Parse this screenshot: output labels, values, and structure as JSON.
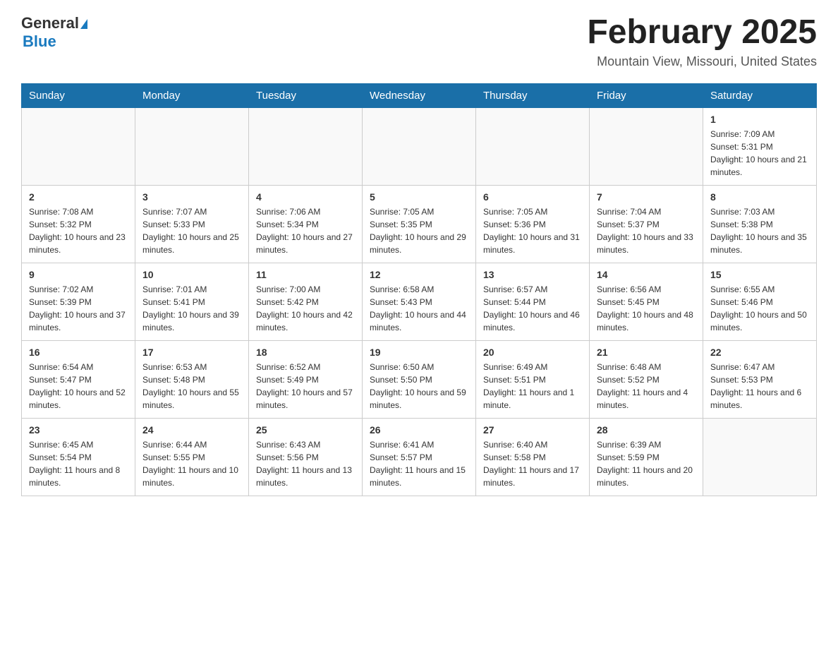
{
  "header": {
    "logo_general": "General",
    "logo_blue": "Blue",
    "month_title": "February 2025",
    "location": "Mountain View, Missouri, United States"
  },
  "days_of_week": [
    "Sunday",
    "Monday",
    "Tuesday",
    "Wednesday",
    "Thursday",
    "Friday",
    "Saturday"
  ],
  "weeks": [
    [
      {
        "day": "",
        "info": ""
      },
      {
        "day": "",
        "info": ""
      },
      {
        "day": "",
        "info": ""
      },
      {
        "day": "",
        "info": ""
      },
      {
        "day": "",
        "info": ""
      },
      {
        "day": "",
        "info": ""
      },
      {
        "day": "1",
        "info": "Sunrise: 7:09 AM\nSunset: 5:31 PM\nDaylight: 10 hours and 21 minutes."
      }
    ],
    [
      {
        "day": "2",
        "info": "Sunrise: 7:08 AM\nSunset: 5:32 PM\nDaylight: 10 hours and 23 minutes."
      },
      {
        "day": "3",
        "info": "Sunrise: 7:07 AM\nSunset: 5:33 PM\nDaylight: 10 hours and 25 minutes."
      },
      {
        "day": "4",
        "info": "Sunrise: 7:06 AM\nSunset: 5:34 PM\nDaylight: 10 hours and 27 minutes."
      },
      {
        "day": "5",
        "info": "Sunrise: 7:05 AM\nSunset: 5:35 PM\nDaylight: 10 hours and 29 minutes."
      },
      {
        "day": "6",
        "info": "Sunrise: 7:05 AM\nSunset: 5:36 PM\nDaylight: 10 hours and 31 minutes."
      },
      {
        "day": "7",
        "info": "Sunrise: 7:04 AM\nSunset: 5:37 PM\nDaylight: 10 hours and 33 minutes."
      },
      {
        "day": "8",
        "info": "Sunrise: 7:03 AM\nSunset: 5:38 PM\nDaylight: 10 hours and 35 minutes."
      }
    ],
    [
      {
        "day": "9",
        "info": "Sunrise: 7:02 AM\nSunset: 5:39 PM\nDaylight: 10 hours and 37 minutes."
      },
      {
        "day": "10",
        "info": "Sunrise: 7:01 AM\nSunset: 5:41 PM\nDaylight: 10 hours and 39 minutes."
      },
      {
        "day": "11",
        "info": "Sunrise: 7:00 AM\nSunset: 5:42 PM\nDaylight: 10 hours and 42 minutes."
      },
      {
        "day": "12",
        "info": "Sunrise: 6:58 AM\nSunset: 5:43 PM\nDaylight: 10 hours and 44 minutes."
      },
      {
        "day": "13",
        "info": "Sunrise: 6:57 AM\nSunset: 5:44 PM\nDaylight: 10 hours and 46 minutes."
      },
      {
        "day": "14",
        "info": "Sunrise: 6:56 AM\nSunset: 5:45 PM\nDaylight: 10 hours and 48 minutes."
      },
      {
        "day": "15",
        "info": "Sunrise: 6:55 AM\nSunset: 5:46 PM\nDaylight: 10 hours and 50 minutes."
      }
    ],
    [
      {
        "day": "16",
        "info": "Sunrise: 6:54 AM\nSunset: 5:47 PM\nDaylight: 10 hours and 52 minutes."
      },
      {
        "day": "17",
        "info": "Sunrise: 6:53 AM\nSunset: 5:48 PM\nDaylight: 10 hours and 55 minutes."
      },
      {
        "day": "18",
        "info": "Sunrise: 6:52 AM\nSunset: 5:49 PM\nDaylight: 10 hours and 57 minutes."
      },
      {
        "day": "19",
        "info": "Sunrise: 6:50 AM\nSunset: 5:50 PM\nDaylight: 10 hours and 59 minutes."
      },
      {
        "day": "20",
        "info": "Sunrise: 6:49 AM\nSunset: 5:51 PM\nDaylight: 11 hours and 1 minute."
      },
      {
        "day": "21",
        "info": "Sunrise: 6:48 AM\nSunset: 5:52 PM\nDaylight: 11 hours and 4 minutes."
      },
      {
        "day": "22",
        "info": "Sunrise: 6:47 AM\nSunset: 5:53 PM\nDaylight: 11 hours and 6 minutes."
      }
    ],
    [
      {
        "day": "23",
        "info": "Sunrise: 6:45 AM\nSunset: 5:54 PM\nDaylight: 11 hours and 8 minutes."
      },
      {
        "day": "24",
        "info": "Sunrise: 6:44 AM\nSunset: 5:55 PM\nDaylight: 11 hours and 10 minutes."
      },
      {
        "day": "25",
        "info": "Sunrise: 6:43 AM\nSunset: 5:56 PM\nDaylight: 11 hours and 13 minutes."
      },
      {
        "day": "26",
        "info": "Sunrise: 6:41 AM\nSunset: 5:57 PM\nDaylight: 11 hours and 15 minutes."
      },
      {
        "day": "27",
        "info": "Sunrise: 6:40 AM\nSunset: 5:58 PM\nDaylight: 11 hours and 17 minutes."
      },
      {
        "day": "28",
        "info": "Sunrise: 6:39 AM\nSunset: 5:59 PM\nDaylight: 11 hours and 20 minutes."
      },
      {
        "day": "",
        "info": ""
      }
    ]
  ]
}
